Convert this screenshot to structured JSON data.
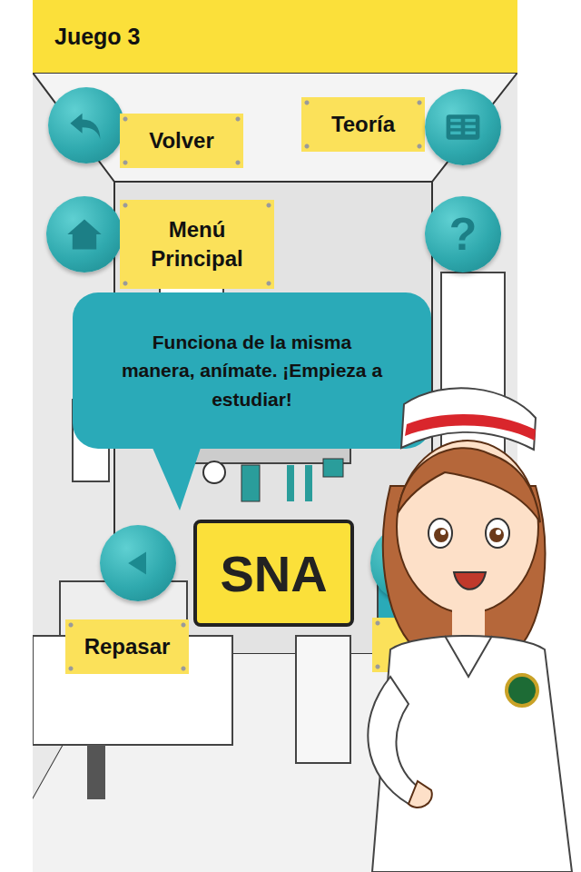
{
  "header": {
    "title": "Juego 3"
  },
  "labels": {
    "back": "Volver",
    "theory": "Teoría",
    "home": "Menú Principal",
    "review": "Repasar"
  },
  "help": {
    "glyph": "?"
  },
  "bubble": {
    "text": "Funciona de la misma manera, anímate. ¡Empieza a estudiar!"
  },
  "sign": {
    "text": "SNA"
  }
}
